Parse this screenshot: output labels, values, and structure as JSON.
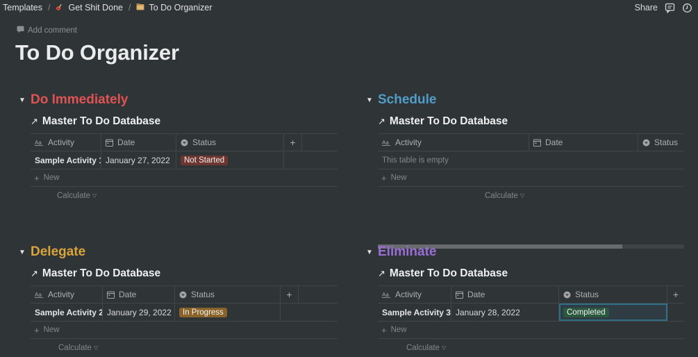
{
  "breadcrumb": [
    {
      "label": "Templates",
      "icon": ""
    },
    {
      "label": "Get Shit Done",
      "icon": "guitar-icon"
    },
    {
      "label": "To Do Organizer",
      "icon": "folder-icon"
    }
  ],
  "topbar": {
    "share_label": "Share"
  },
  "page": {
    "add_comment": "Add comment",
    "title": "To Do Organizer"
  },
  "colors": {
    "do_immediately": "#df5452",
    "schedule": "#529cca",
    "delegate": "#d9a43b",
    "eliminate": "#9a6dd7",
    "not_started": "#6e3630",
    "in_progress": "#89632a",
    "completed": "#2b593f"
  },
  "sections": {
    "do_immediately": {
      "title": "Do Immediately",
      "db_title": "Master To Do Database",
      "columns": [
        "Activity",
        "Date",
        "Status"
      ],
      "rows": [
        {
          "activity": "Sample Activity 1-",
          "date": "January 27, 2022",
          "status": "Not Started"
        }
      ],
      "new_label": "New",
      "calculate_label": "Calculate"
    },
    "schedule": {
      "title": "Schedule",
      "db_title": "Master To Do Database",
      "columns": [
        "Activity",
        "Date",
        "Status"
      ],
      "empty_text": "This table is empty",
      "new_label": "New",
      "calculate_label": "Calculate"
    },
    "delegate": {
      "title": "Delegate",
      "db_title": "Master To Do Database",
      "columns": [
        "Activity",
        "Date",
        "Status"
      ],
      "rows": [
        {
          "activity": "Sample Activity 2-",
          "date": "January 29, 2022",
          "status": "In Progress"
        }
      ],
      "new_label": "New",
      "calculate_label": "Calculate"
    },
    "eliminate": {
      "title": "Eliminate",
      "db_title": "Master To Do Database",
      "columns": [
        "Activity",
        "Date",
        "Status"
      ],
      "rows": [
        {
          "activity": "Sample Activity 3-",
          "date": "January 28, 2022",
          "status": "Completed"
        }
      ],
      "new_label": "New",
      "calculate_label": "Calculate"
    }
  }
}
